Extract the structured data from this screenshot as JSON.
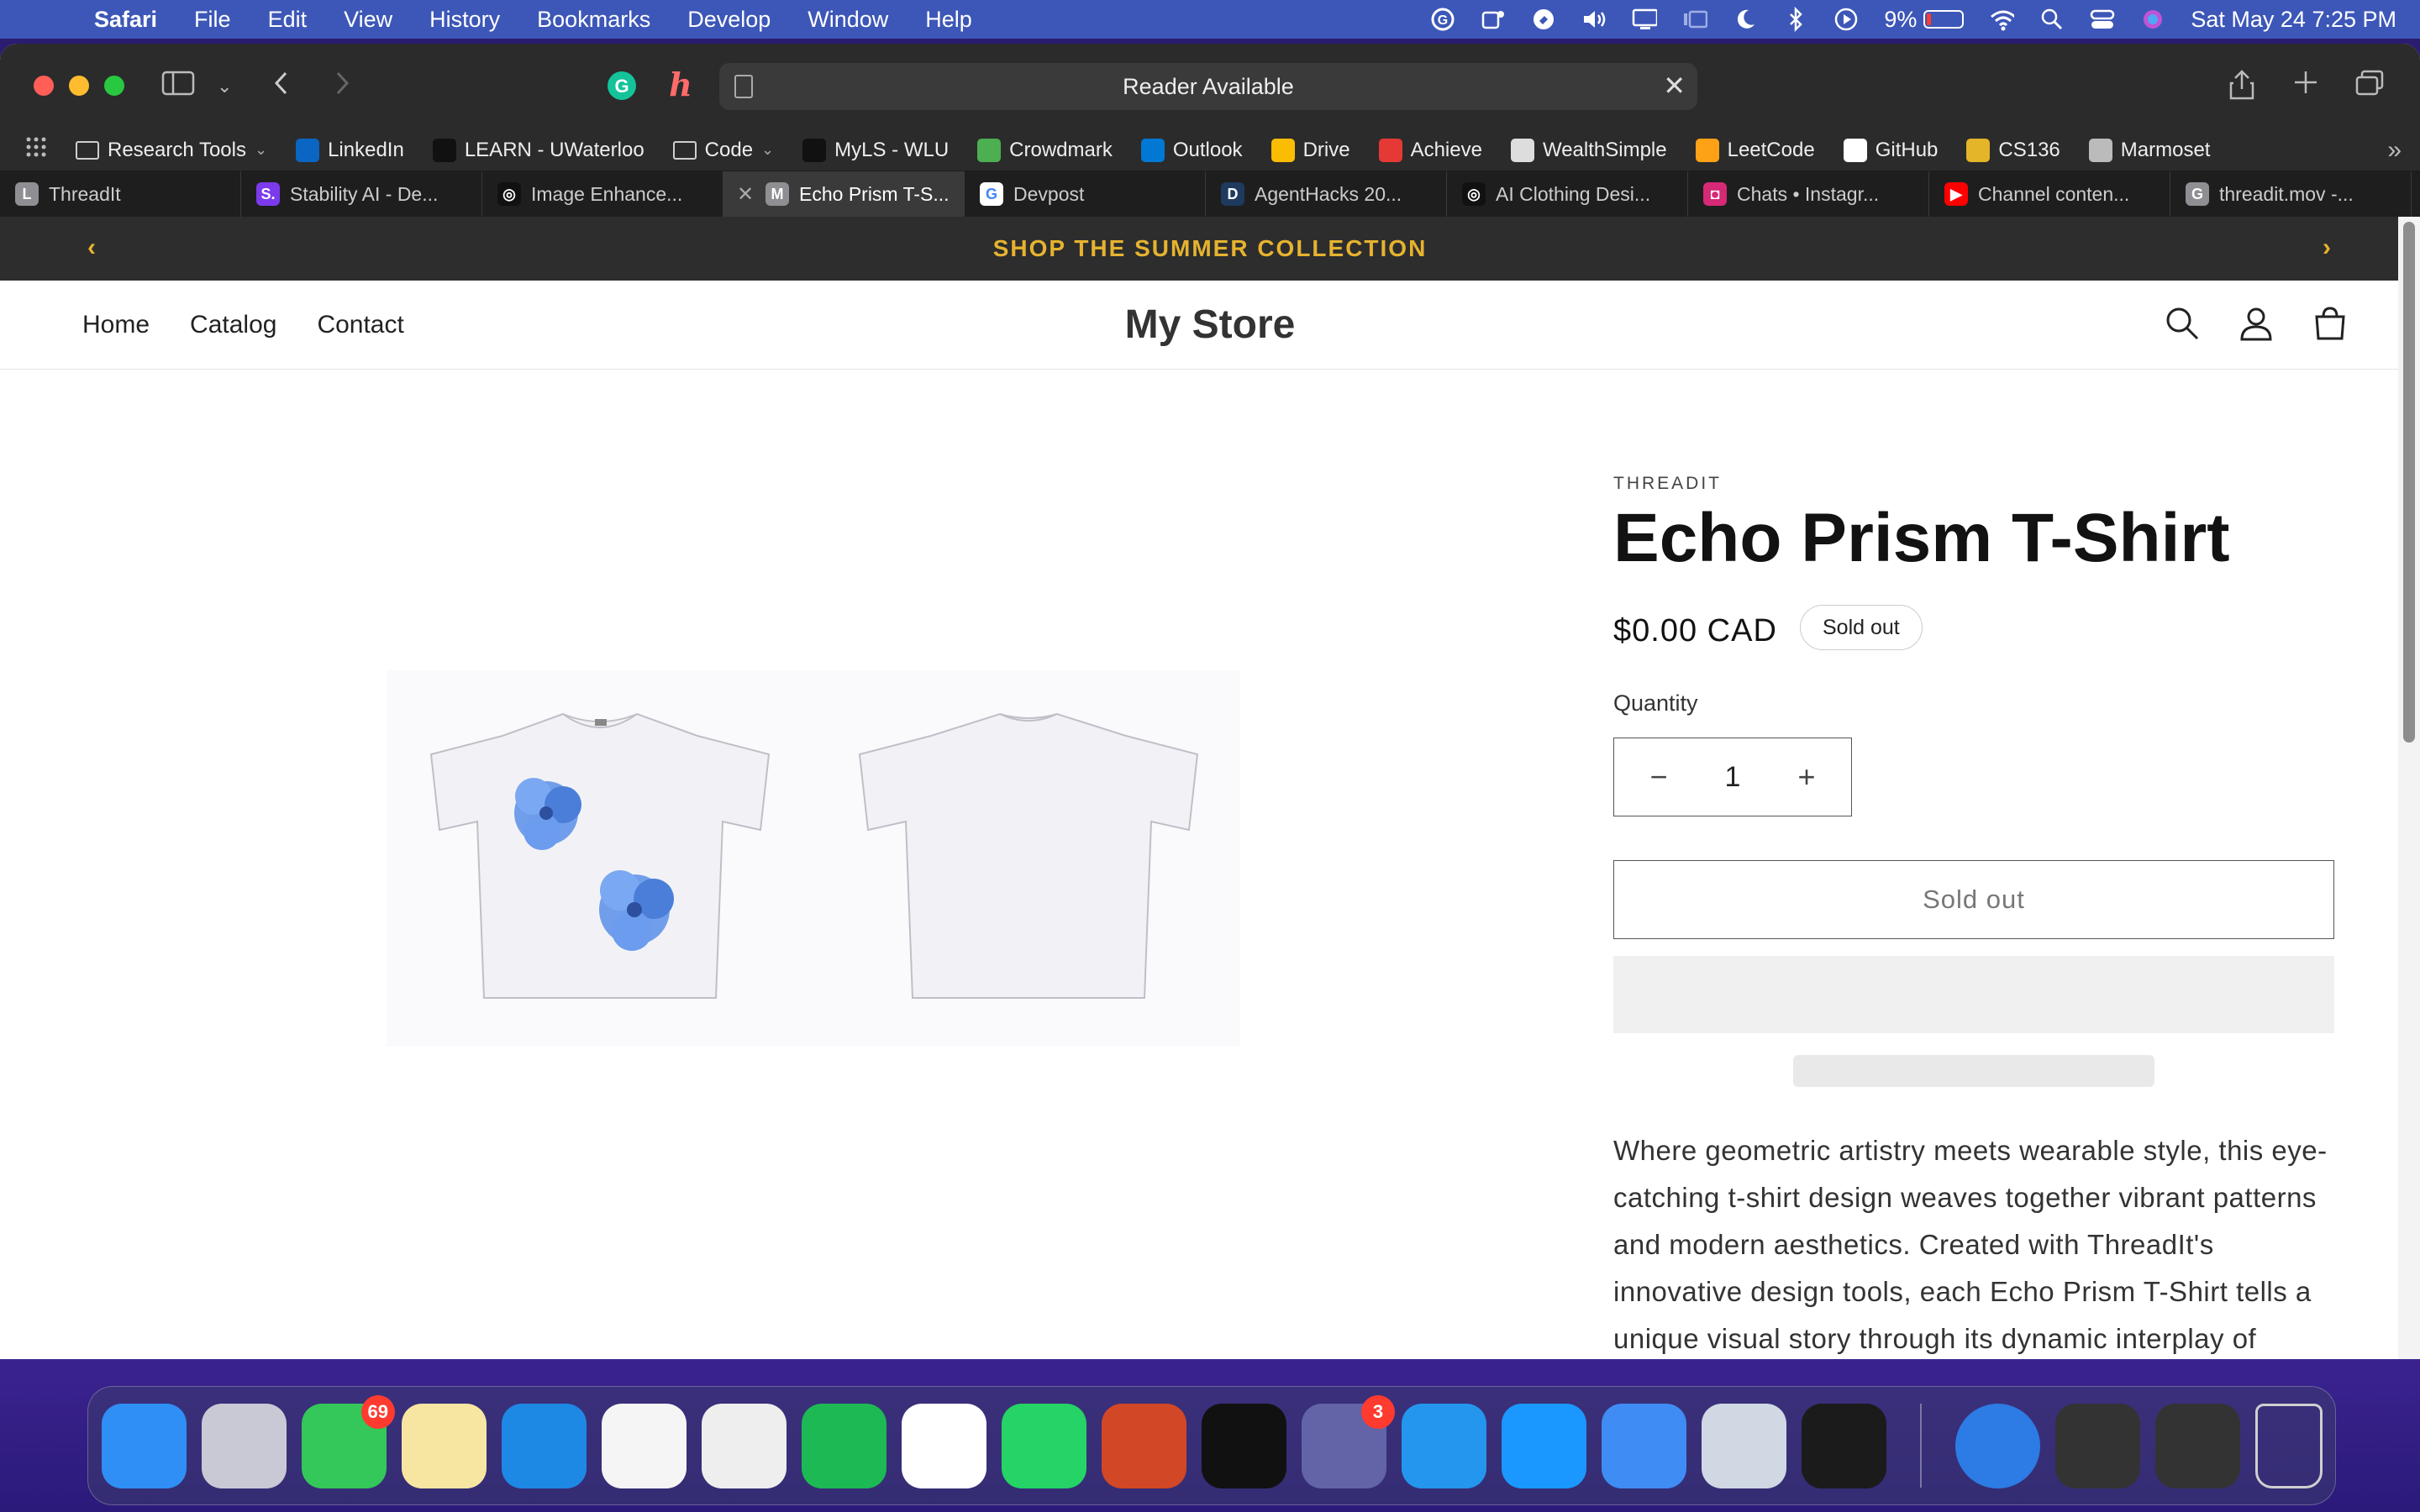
{
  "menubar": {
    "app": "Safari",
    "items": [
      "File",
      "Edit",
      "View",
      "History",
      "Bookmarks",
      "Develop",
      "Window",
      "Help"
    ],
    "battery": "9%",
    "datetime": "Sat May 24  7:25 PM"
  },
  "browser": {
    "url_text": "Reader Available",
    "bookmarks": [
      {
        "label": "Research Tools",
        "icon": "folder-icon",
        "color": "#cfcfcf"
      },
      {
        "label": "LinkedIn",
        "icon": "linkedin-icon",
        "color": "#0a66c2"
      },
      {
        "label": "LEARN - UWaterloo",
        "icon": "d2l-icon",
        "color": "#111111"
      },
      {
        "label": "Code",
        "icon": "folder-icon",
        "color": "#cfcfcf"
      },
      {
        "label": "MyLS - WLU",
        "icon": "d2l-icon",
        "color": "#111111"
      },
      {
        "label": "Crowdmark",
        "icon": "crowdmark-icon",
        "color": "#4caf50"
      },
      {
        "label": "Outlook",
        "icon": "outlook-icon",
        "color": "#0078d4"
      },
      {
        "label": "Drive",
        "icon": "drive-icon",
        "color": "#fbbc04"
      },
      {
        "label": "Achieve",
        "icon": "achieve-icon",
        "color": "#e53935"
      },
      {
        "label": "WealthSimple",
        "icon": "wealthsimple-icon",
        "color": "#dddddd"
      },
      {
        "label": "LeetCode",
        "icon": "leetcode-icon",
        "color": "#ffa116"
      },
      {
        "label": "GitHub",
        "icon": "github-icon",
        "color": "#ffffff"
      },
      {
        "label": "CS136",
        "icon": "uwaterloo-icon",
        "color": "#e4b429"
      },
      {
        "label": "Marmoset",
        "icon": "globe-icon",
        "color": "#bbbbbb"
      }
    ],
    "tabs": [
      {
        "label": "ThreadIt",
        "letter": "L",
        "color": "#8e8e93",
        "active": false
      },
      {
        "label": "Stability AI - De...",
        "letter": "S.",
        "color": "#7c3aed",
        "active": false
      },
      {
        "label": "Image Enhance...",
        "letter": "◎",
        "color": "#111111",
        "active": false
      },
      {
        "label": "Echo Prism T-S...",
        "letter": "M",
        "color": "#8e8e93",
        "active": true
      },
      {
        "label": "Devpost",
        "letter": "G",
        "color": "#ffffff",
        "active": false
      },
      {
        "label": "AgentHacks 20...",
        "letter": "D",
        "color": "#1e3a5f",
        "active": false
      },
      {
        "label": "AI Clothing Desi...",
        "letter": "◎",
        "color": "#111111",
        "active": false
      },
      {
        "label": "Chats • Instagr...",
        "letter": "◘",
        "color": "#d62976",
        "active": false
      },
      {
        "label": "Channel conten...",
        "letter": "▶",
        "color": "#ff0000",
        "active": false
      },
      {
        "label": "threadit.mov -...",
        "letter": "G",
        "color": "#8e8e93",
        "active": false
      }
    ]
  },
  "store": {
    "announcement": "SHOP THE SUMMER COLLECTION",
    "nav": [
      "Home",
      "Catalog",
      "Contact"
    ],
    "name": "My Store",
    "accent": "#e6b32f"
  },
  "product": {
    "vendor": "THREADIT",
    "title": "Echo Prism T-Shirt",
    "price": "$0.00 CAD",
    "badge": "Sold out",
    "quantity_label": "Quantity",
    "quantity": "1",
    "button": "Sold out",
    "description": "Where geometric artistry meets wearable style, this eye-catching t-shirt design weaves together vibrant patterns and modern aesthetics. Created with ThreadIt's innovative design tools, each Echo Prism T-Shirt tells a unique visual story through its dynamic interplay of shapes and colors. Perfect for"
  },
  "dock": {
    "apps": [
      {
        "name": "finder",
        "color": "#2f8ff5",
        "badge": ""
      },
      {
        "name": "launchpad",
        "color": "#c9c9d6",
        "badge": ""
      },
      {
        "name": "messages",
        "color": "#34c759",
        "badge": "69"
      },
      {
        "name": "notes",
        "color": "#f7e6a2",
        "badge": ""
      },
      {
        "name": "safari",
        "color": "#1e88e5",
        "badge": ""
      },
      {
        "name": "photos",
        "color": "#f5f5f5",
        "badge": ""
      },
      {
        "name": "chrome",
        "color": "#eeeeee",
        "badge": ""
      },
      {
        "name": "spotify",
        "color": "#1db954",
        "badge": ""
      },
      {
        "name": "vscode",
        "color": "#ffffff",
        "badge": ""
      },
      {
        "name": "whatsapp",
        "color": "#25d366",
        "badge": ""
      },
      {
        "name": "powerpoint",
        "color": "#d24726",
        "badge": ""
      },
      {
        "name": "unity",
        "color": "#111111",
        "badge": ""
      },
      {
        "name": "teams",
        "color": "#6264a7",
        "badge": "3"
      },
      {
        "name": "docker",
        "color": "#2496ed",
        "badge": ""
      },
      {
        "name": "prime-video",
        "color": "#1a98ff",
        "badge": ""
      },
      {
        "name": "xcode",
        "color": "#3f8cf5",
        "badge": ""
      },
      {
        "name": "preview",
        "color": "#cfd8e3",
        "badge": ""
      },
      {
        "name": "terminal",
        "color": "#1b1b1b",
        "badge": ""
      }
    ],
    "extras": [
      {
        "name": "globe",
        "color": "#2d7be5"
      },
      {
        "name": "window-preview-1",
        "color": "#333333"
      },
      {
        "name": "window-preview-2",
        "color": "#333333"
      },
      {
        "name": "trash",
        "color": "#cfcfcf"
      }
    ]
  }
}
